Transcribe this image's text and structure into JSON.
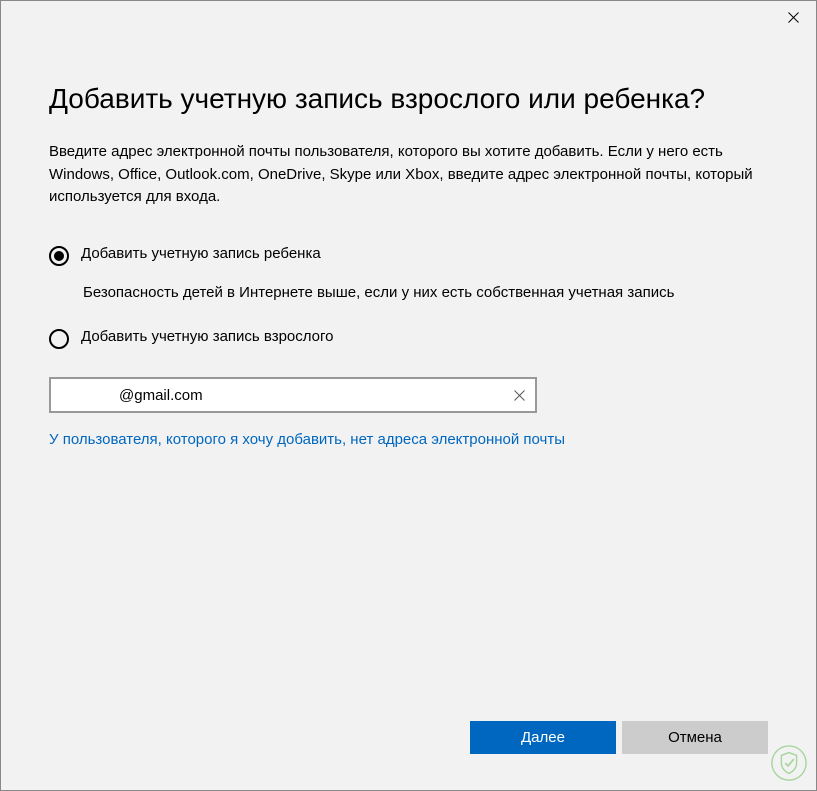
{
  "dialog": {
    "heading": "Добавить учетную запись взрослого или ребенка?",
    "description": "Введите адрес электронной почты пользователя, которого вы хотите добавить. Если у него есть Windows, Office, Outlook.com, OneDrive, Skype или Xbox, введите адрес электронной почты, который используется для входа.",
    "options": {
      "child": {
        "label": "Добавить учетную запись ребенка",
        "sub": "Безопасность детей в Интернете выше, если у них есть собственная учетная запись",
        "selected": true
      },
      "adult": {
        "label": "Добавить учетную запись взрослого",
        "selected": false
      }
    },
    "email": {
      "value": "@gmail.com"
    },
    "no_email_link": "У пользователя, которого я хочу добавить, нет адреса электронной почты",
    "buttons": {
      "next": "Далее",
      "cancel": "Отмена"
    }
  }
}
